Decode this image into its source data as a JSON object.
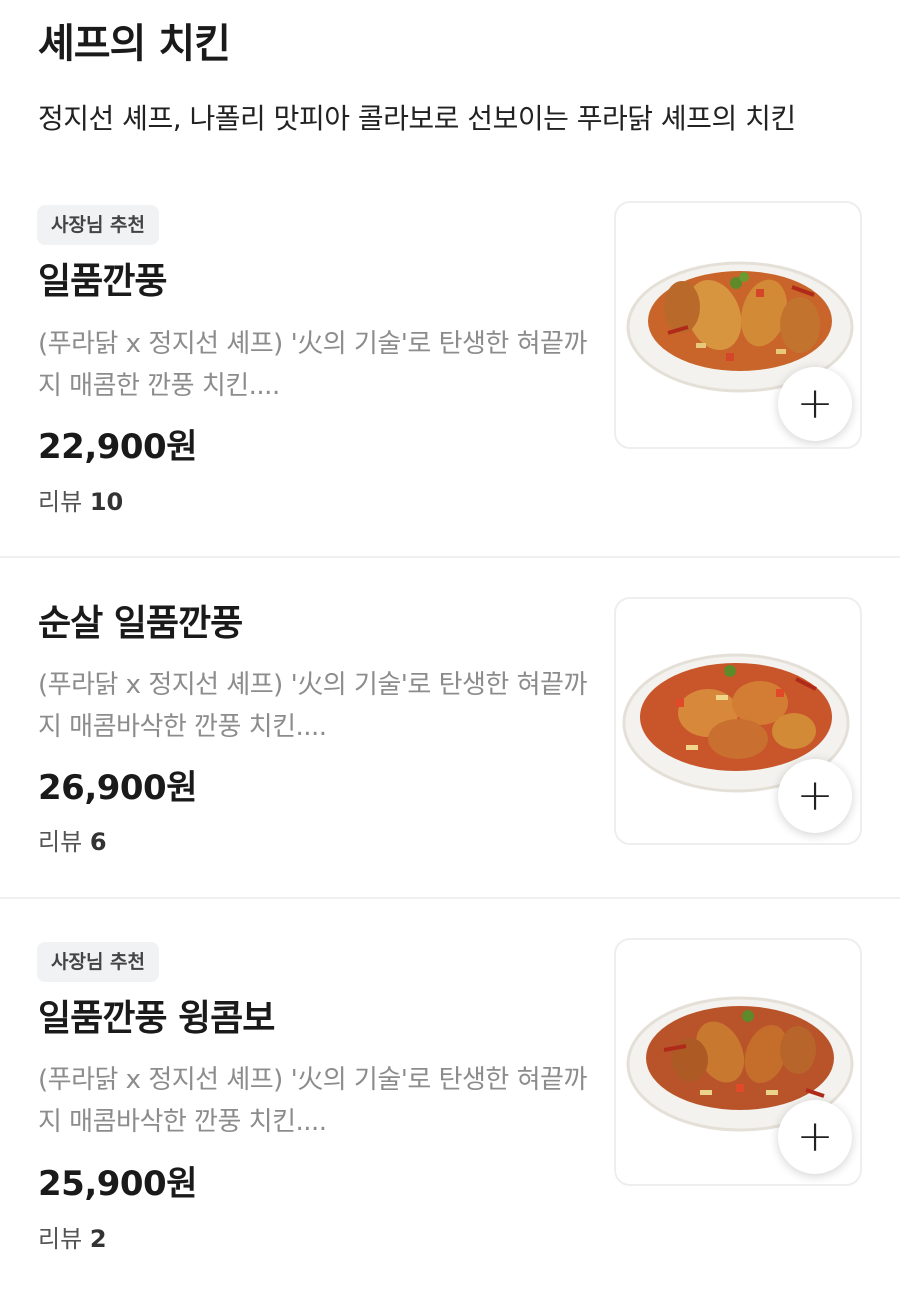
{
  "section": {
    "title": "셰프의 치킨",
    "description": "정지선 셰프, 나폴리 맛피아 콜라보로 선보이는 푸라닭 셰프의 치킨"
  },
  "items": [
    {
      "badge": "사장님 추천",
      "name": "일품깐풍",
      "description": "(푸라닭 x 정지선 셰프) '火의 기술'로 탄생한 혀끝까지 매콤한 깐풍 치킨....",
      "price": "22,900원",
      "review_label": "리뷰",
      "review_count": "10",
      "add_icon": "plus-icon"
    },
    {
      "badge": null,
      "name": "순살 일품깐풍",
      "description": "(푸라닭 x 정지선 셰프) '火의 기술'로 탄생한 혀끝까지 매콤바삭한 깐풍 치킨....",
      "price": "26,900원",
      "review_label": "리뷰",
      "review_count": "6",
      "add_icon": "plus-icon"
    },
    {
      "badge": "사장님 추천",
      "name": "일품깐풍 윙콤보",
      "description": "(푸라닭 x 정지선 셰프) '火의 기술'로 탄생한 혀끝까지 매콤바삭한 깐풍 치킨....",
      "price": "25,900원",
      "review_label": "리뷰",
      "review_count": "2",
      "add_icon": "plus-icon"
    }
  ],
  "colors": {
    "badge_bg": "#f1f2f4",
    "muted_text": "#8c8c8c",
    "divider": "#f0f0f0"
  }
}
